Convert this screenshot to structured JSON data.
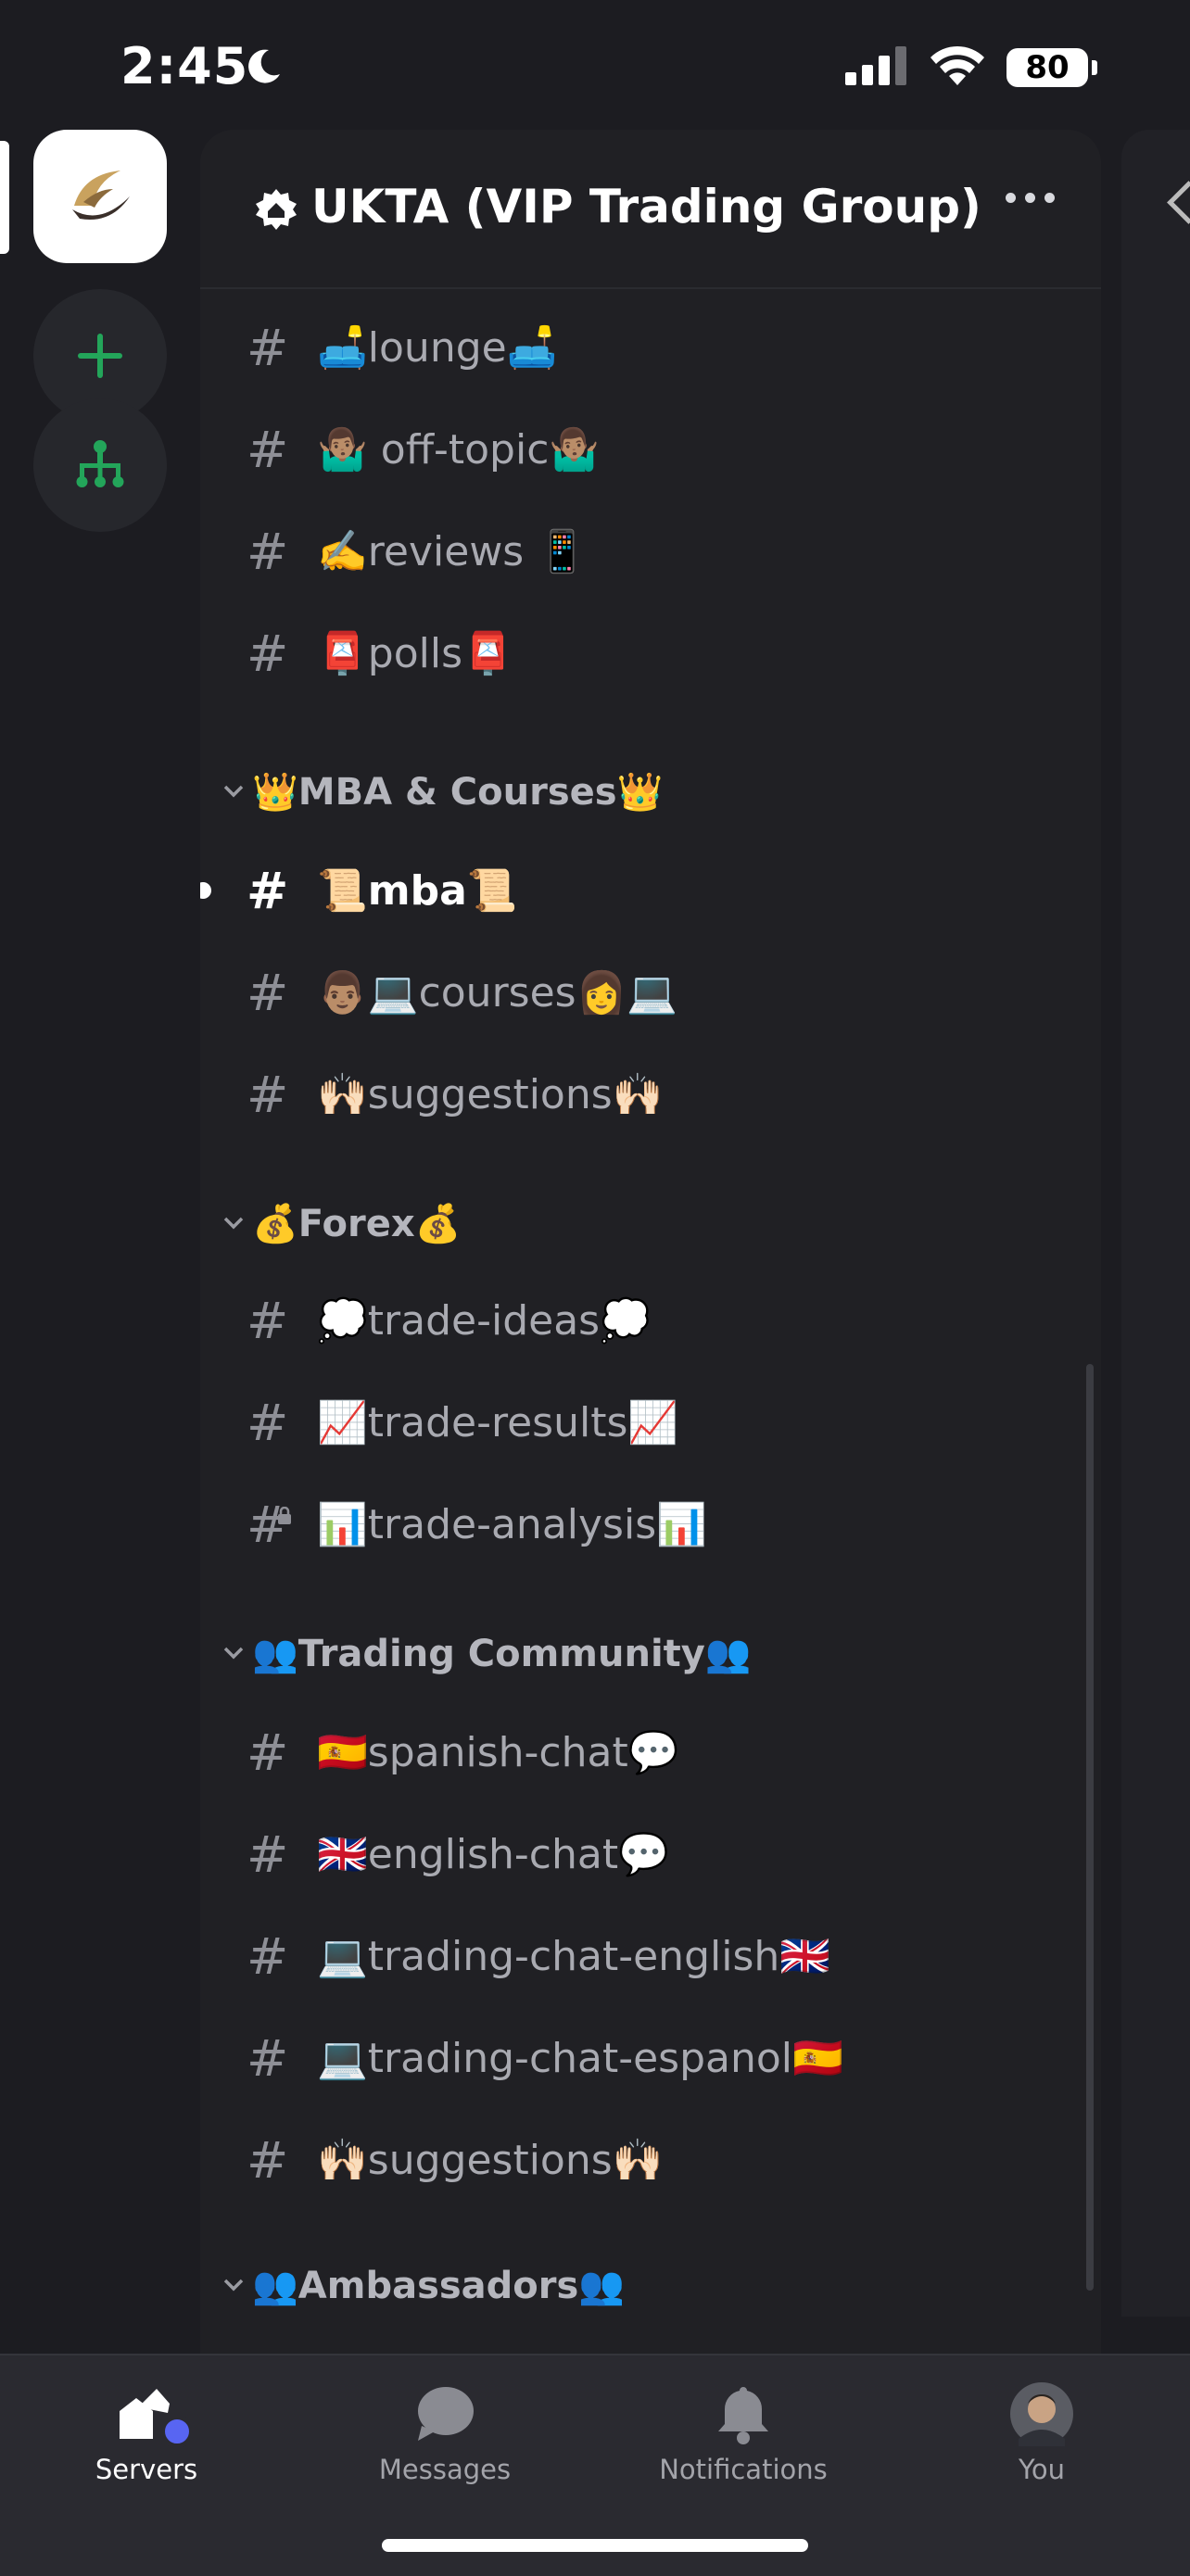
{
  "status_bar": {
    "time": "2:45",
    "battery": "80"
  },
  "server": {
    "name": "UKTA (VIP Trading Group)"
  },
  "top_channels": [
    {
      "label": "🛋️lounge🛋️"
    },
    {
      "label": "🤷🏽‍♂ off-topic🤷🏽‍♂"
    },
    {
      "label": "✍️reviews 📱"
    },
    {
      "label": "📮polls📮"
    }
  ],
  "categories": [
    {
      "label": "👑MBA & Courses👑",
      "channels": [
        {
          "label": "📜mba📜"
        },
        {
          "label": "👨🏽💻courses👩💻"
        },
        {
          "label": "🙌🏻suggestions🙌🏻"
        }
      ]
    },
    {
      "label": "💰Forex💰",
      "channels": [
        {
          "label": "💭trade-ideas💭"
        },
        {
          "label": "📈trade-results📈"
        },
        {
          "label": "📊trade-analysis📊"
        }
      ]
    },
    {
      "label": "👥Trading Community👥",
      "channels": [
        {
          "label": "🇪🇸spanish-chat💬"
        },
        {
          "label": "🇬🇧english-chat💬"
        },
        {
          "label": "💻trading-chat-english🇬🇧"
        },
        {
          "label": "💻trading-chat-espanol🇪🇸"
        },
        {
          "label": "🙌🏻suggestions🙌🏻"
        }
      ]
    },
    {
      "label": "👥Ambassadors👥"
    }
  ],
  "channel_prefix": "#",
  "tabs": [
    {
      "label": "Servers"
    },
    {
      "label": "Messages"
    },
    {
      "label": "Notifications"
    },
    {
      "label": "You"
    }
  ],
  "colors": {
    "accent": "#5865f2",
    "add_green": "#23a55a",
    "background": "#1c1c21",
    "panel": "#202024"
  }
}
